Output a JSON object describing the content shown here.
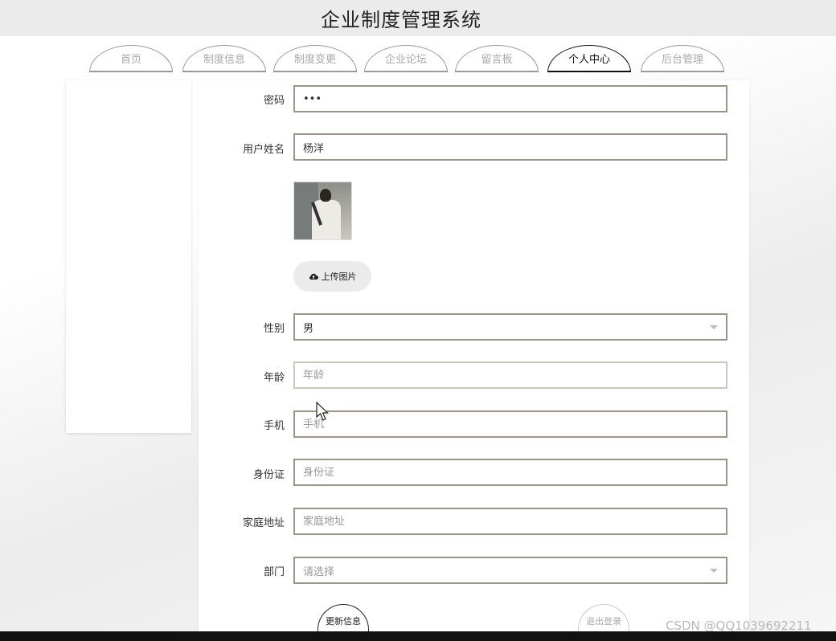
{
  "header": {
    "title": "企业制度管理系统"
  },
  "nav": {
    "tabs": [
      {
        "label": "首页",
        "active": false
      },
      {
        "label": "制度信息",
        "active": false
      },
      {
        "label": "制度变更",
        "active": false
      },
      {
        "label": "企业论坛",
        "active": false
      },
      {
        "label": "留言板",
        "active": false
      },
      {
        "label": "个人中心",
        "active": true
      },
      {
        "label": "后台管理",
        "active": false
      }
    ]
  },
  "form": {
    "password": {
      "label": "密码",
      "value": "•••"
    },
    "name": {
      "label": "用户姓名",
      "value": "杨洋"
    },
    "upload_label": "上传图片",
    "gender": {
      "label": "性别",
      "value": "男"
    },
    "age": {
      "label": "年龄",
      "placeholder": "年龄"
    },
    "phone": {
      "label": "手机",
      "placeholder": "手机"
    },
    "id_card": {
      "label": "身份证",
      "placeholder": "身份证"
    },
    "address": {
      "label": "家庭地址",
      "placeholder": "家庭地址"
    },
    "department": {
      "label": "部门",
      "placeholder": "请选择"
    },
    "update_label": "更新信息",
    "logout_label": "退出登录"
  },
  "watermark": "CSDN @QQ1039692211"
}
